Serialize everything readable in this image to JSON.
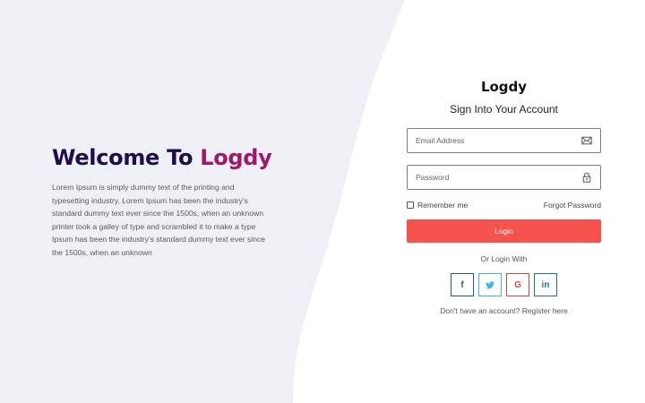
{
  "hero": {
    "title_prefix": "Welcome To ",
    "title_brand": "Logdy",
    "description": "Lorem Ipsum is simply dummy text of the printing and typesetting industry. Lorem Ipsum has been the industry's standard dummy text ever since the 1500s, when an unknown printer took a galley of type and scrambled it to make a type Ipsum has been the industry's standard dummy text ever since the 1500s, when an unknown"
  },
  "form": {
    "logo": "Logdy",
    "subtitle": "Sign Into Your Account",
    "email_placeholder": "Email Address",
    "password_placeholder": "Password",
    "remember_label": "Remember me",
    "forgot_label": "Forgot Password",
    "login_label": "Login",
    "or_label": "Or Login With",
    "signup_prompt": "Don't have an account?",
    "signup_link": "Register here"
  },
  "socials": [
    {
      "icon": "facebook-icon",
      "glyph": "f"
    },
    {
      "icon": "twitter-icon",
      "glyph": "t"
    },
    {
      "icon": "google-icon",
      "glyph": "G"
    },
    {
      "icon": "linkedin-icon",
      "glyph": "in"
    }
  ],
  "colors": {
    "accent": "#f5524c",
    "title_dark": "#1f0b4f",
    "title_brand": "#a0186c",
    "panel_bg": "#eef0f5"
  }
}
